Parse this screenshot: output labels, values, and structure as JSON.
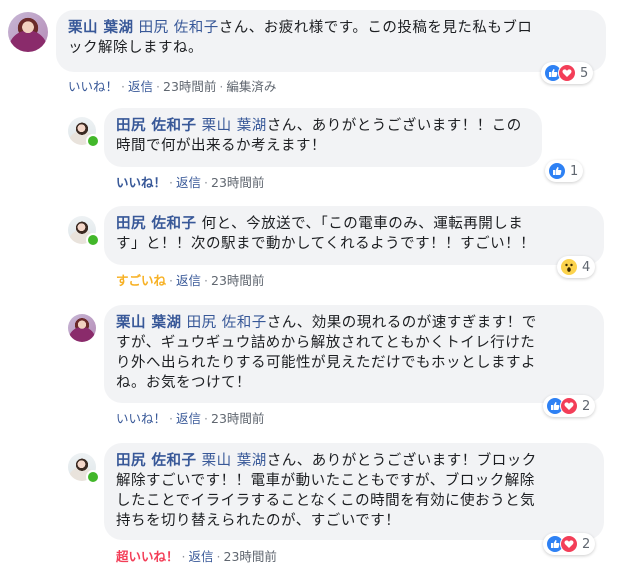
{
  "comments": [
    {
      "author": "栗山 葉湖",
      "mention": "田尻 佐和子",
      "text_line1": "さん、お疲れ様です。この投稿を見た私もブロ",
      "text_line2": "ック解除しますね。",
      "reaction_label": "いいね！",
      "reply": "返信",
      "time": "23時間前",
      "edited": "編集済み",
      "reaction_count": "5"
    },
    {
      "author": "田尻 佐和子",
      "mention": "栗山 葉湖",
      "text_line1": "さん、ありがとうございます！！この",
      "text_line2": "時間で何が出来るか考えます！",
      "reaction_label": "いいね！",
      "reply": "返信",
      "time": "23時間前",
      "reaction_count": "1"
    },
    {
      "author": "田尻 佐和子",
      "text_line1": "何と、今放送で、「この電車のみ、運転再開しま",
      "text_line2": "す」と！！次の駅まで動かしてくれるようです！！すごい！！",
      "reaction_label": "すごいね",
      "reply": "返信",
      "time": "23時間前",
      "reaction_count": "4"
    },
    {
      "author": "栗山 葉湖",
      "mention": "田尻 佐和子",
      "text_line1": "さん、効果の現れるのが速すぎます！で",
      "text_line2": "すが、ギュウギュウ詰めから解放されてともかくトイレ行けた",
      "text_line3": "り外へ出られたりする可能性が見えただけでもホッとしますよ",
      "text_line4": "ね。お気をつけて！",
      "reaction_label": "いいね！",
      "reply": "返信",
      "time": "23時間前",
      "reaction_count": "2"
    },
    {
      "author": "田尻 佐和子",
      "mention": "栗山 葉湖",
      "text_line1": "さん、ありがとうございます！ブロック",
      "text_line2": "解除すごいです！！電車が動いたこともですが、ブロック解除",
      "text_line3": "したことでイライラすることなくこの時間を有効に使おうと気",
      "text_line4": "持ちを切り替えられたのが、すごいです！",
      "reaction_label": "超いいね！",
      "reply": "返信",
      "time": "23時間前",
      "reaction_count": "2"
    }
  ],
  "meta_separator": "·",
  "icons": {
    "like": "thumbs-up-icon",
    "love": "heart-icon",
    "wow": "wow-face-icon"
  },
  "colors": {
    "link": "#385898",
    "like_blue": "#2e81f4",
    "love_red": "#f33e58",
    "wow_yellow": "#f7b125",
    "bubble_bg": "#f2f3f5",
    "online_green": "#42b72a"
  }
}
